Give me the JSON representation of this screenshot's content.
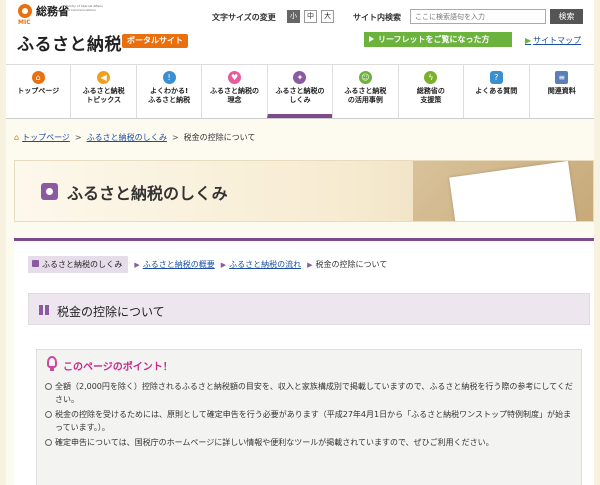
{
  "header": {
    "ministry": "総務省",
    "mic": "MIC",
    "ministry_en": "Ministry of Internal Affairs and Communications",
    "site_title": "ふるさと納税",
    "portal_badge": "ポータルサイト",
    "fontsize_label": "文字サイズの変更",
    "fontsize_options": [
      "小",
      "中",
      "大"
    ],
    "fontsize_selected": "小",
    "search_label": "サイト内検索",
    "search_placeholder": "ここに検索語句を入力",
    "search_button": "検索",
    "leaflet_button": "リーフレットをご覧になった方",
    "sitemap_link": "サイトマップ"
  },
  "nav": {
    "items": [
      {
        "label": "トップページ",
        "icon": "home-icon",
        "color": "#e8700f"
      },
      {
        "label": "ふるさと納税\nトピックス",
        "icon": "megaphone-icon",
        "color": "#f0a020"
      },
      {
        "label": "よくわかる!\nふるさと納税",
        "icon": "lightbulb-icon",
        "color": "#3a8fd0"
      },
      {
        "label": "ふるさと納税の\n理念",
        "icon": "heart-icon",
        "color": "#e85a9c"
      },
      {
        "label": "ふるさと納税の\nしくみ",
        "icon": "puzzle-icon",
        "color": "#8a5ba0",
        "active": true
      },
      {
        "label": "ふるさと納税\nの活用事例",
        "icon": "smile-icon",
        "color": "#6cb33e"
      },
      {
        "label": "総務省の\n支援策",
        "icon": "lightning-icon",
        "color": "#7ab02a"
      },
      {
        "label": "よくある質問",
        "icon": "question-icon",
        "color": "#3a8fd0"
      },
      {
        "label": "関連資料",
        "icon": "document-icon",
        "color": "#5a7fb8"
      }
    ]
  },
  "breadcrumb": {
    "items": [
      "トップページ",
      "ふるさと納税のしくみ",
      "税金の控除について"
    ],
    "separator": ">"
  },
  "hero": {
    "title": "ふるさと納税のしくみ"
  },
  "subnav": {
    "current": "ふるさと納税のしくみ",
    "links": [
      "ふるさと納税の概要",
      "ふるさと納税の流れ"
    ],
    "active": "税金の控除について"
  },
  "section": {
    "title": "税金の控除について"
  },
  "points": {
    "title": "このページのポイント！",
    "items": [
      "全額（2,000円を除く）控除されるふるさと納税額の目安を、収入と家族構成別で掲載していますので、ふるさと納税を行う際の参考にしてください。",
      "税金の控除を受けるためには、原則として確定申告を行う必要があります（平成27年4月1日から「ふるさと納税ワンストップ特例制度」が始まっています。）。",
      "確定申告については、国税庁のホームページに詳しい情報や便利なツールが掲載されていますので、ぜひご利用ください。"
    ]
  }
}
